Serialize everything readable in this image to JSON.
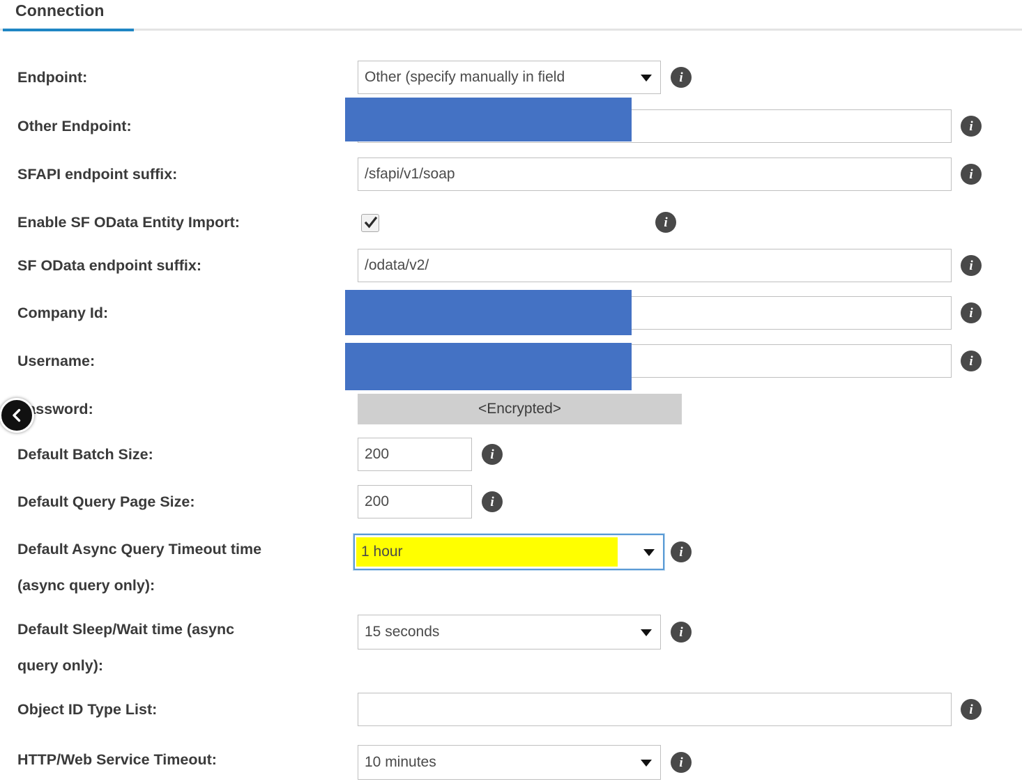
{
  "tab": {
    "label": "Connection",
    "active_underline_color": "#1f86c4"
  },
  "nav": {
    "back_button_name": "chevron-left-icon"
  },
  "colors": {
    "redaction": "#4472c4",
    "highlight": "#ffff00",
    "info_icon": "#494949",
    "encrypted_bg": "#cfcfcf",
    "focus_border": "#5b9bd5"
  },
  "info_icon_label": "i",
  "fields": [
    {
      "label": "Endpoint:",
      "type": "select",
      "value": "Other (specify manually in field",
      "has_info": true,
      "redacted": false
    },
    {
      "label": "Other Endpoint:",
      "type": "text",
      "value": "",
      "has_info": true,
      "redacted": true
    },
    {
      "label": "SFAPI endpoint suffix:",
      "type": "text",
      "value": "/sfapi/v1/soap",
      "has_info": true,
      "redacted": false
    },
    {
      "label": "Enable SF OData Entity Import:",
      "type": "checkbox",
      "value": "checked",
      "has_info": true,
      "redacted": false
    },
    {
      "label": "SF OData endpoint suffix:",
      "type": "text",
      "value": "/odata/v2/",
      "has_info": true,
      "redacted": false
    },
    {
      "label": "Company Id:",
      "type": "text",
      "value": "",
      "has_info": true,
      "redacted": true
    },
    {
      "label": "Username:",
      "type": "text",
      "value": "",
      "has_info": true,
      "redacted": true
    },
    {
      "label": "Password:",
      "type": "readonly",
      "value": "<Encrypted>",
      "has_info": false,
      "redacted": false
    },
    {
      "label": "Default Batch Size:",
      "type": "text-small",
      "value": "200",
      "has_info": true,
      "redacted": false
    },
    {
      "label": "Default Query Page Size:",
      "type": "text-small",
      "value": "200",
      "has_info": true,
      "redacted": false
    },
    {
      "label": "Default Async Query Timeout time\n(async query only):",
      "type": "select-highlighted",
      "value": "1 hour",
      "has_info": true,
      "redacted": false
    },
    {
      "label": "Default Sleep/Wait time (async\nquery only):",
      "type": "select-medium",
      "value": "15 seconds",
      "has_info": true,
      "redacted": false
    },
    {
      "label": "Object ID Type List:",
      "type": "text",
      "value": "",
      "has_info": true,
      "redacted": false
    },
    {
      "label": "HTTP/Web Service Timeout:",
      "type": "select-medium",
      "value": "10 minutes",
      "has_info": true,
      "redacted": false
    }
  ]
}
